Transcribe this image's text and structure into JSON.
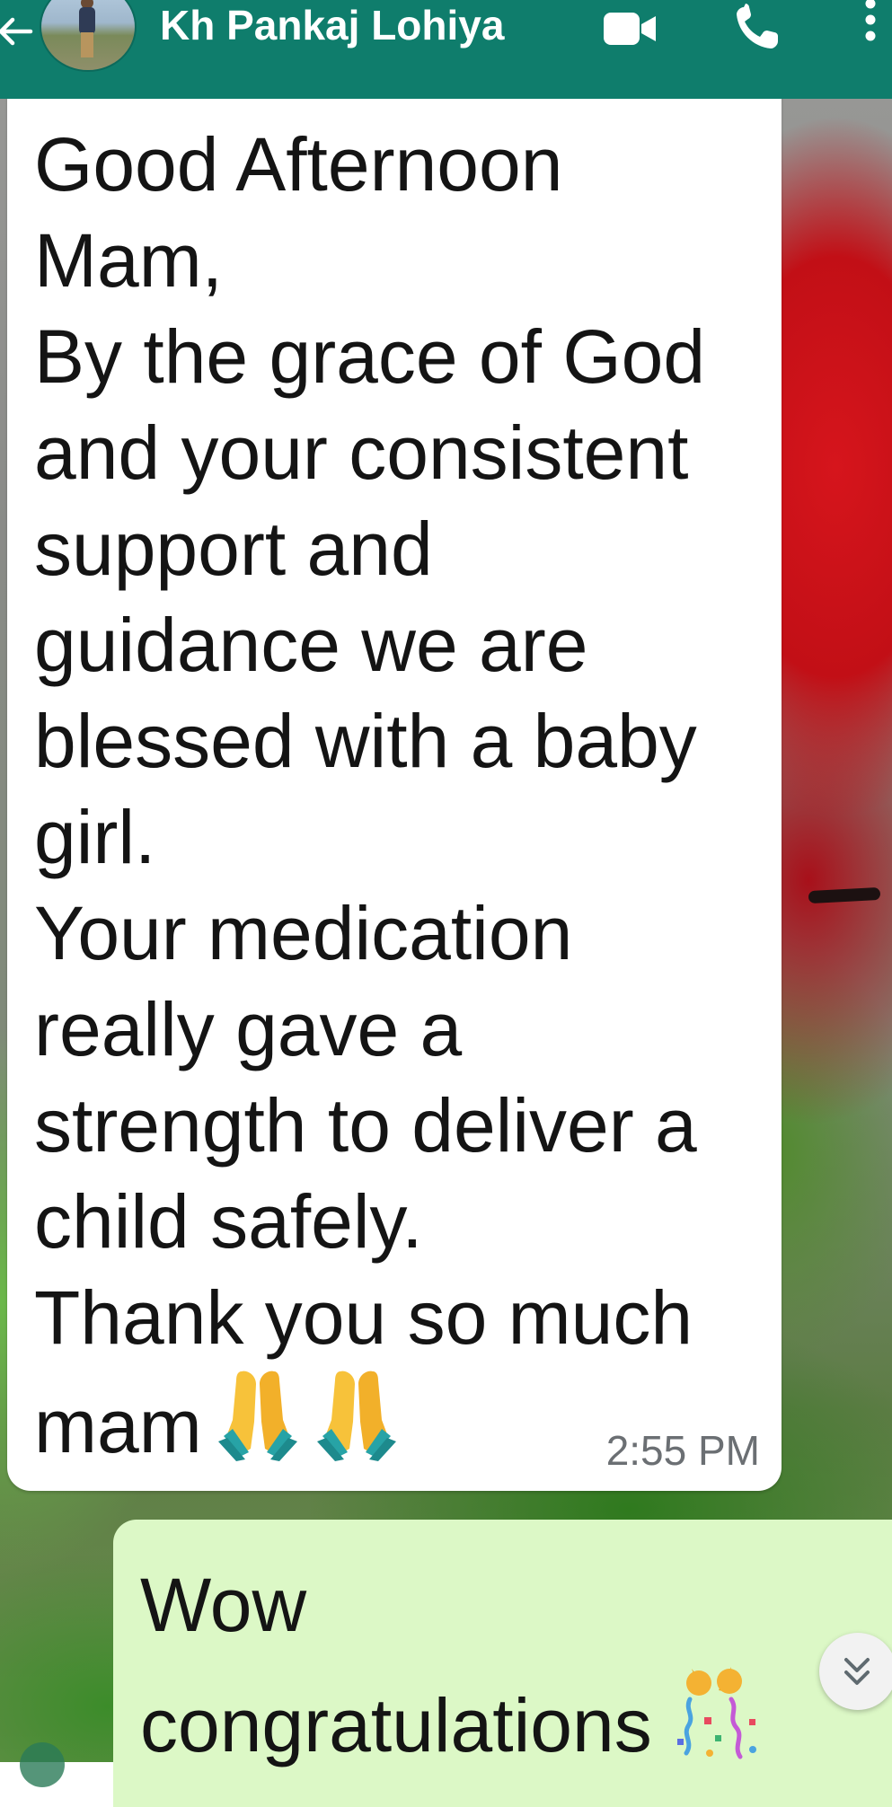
{
  "header": {
    "contact_name": "Kh Pankaj Lohiya",
    "background_color": "#0f7d6c",
    "icons": [
      "back-arrow-icon",
      "video-call-icon",
      "phone-call-icon",
      "more-options-icon"
    ]
  },
  "messages": [
    {
      "direction": "incoming",
      "text": "Good Afternoon\nMam,\nBy the grace of God\nand your consistent\nsupport and\nguidance we are\nblessed with a baby\ngirl.\nYour medication\nreally gave a\nstrength to deliver a\nchild safely.\nThank you so much\nmam",
      "emoji": [
        "folded-hands",
        "folded-hands"
      ],
      "time": "2:55 PM",
      "bubble_color": "#ffffff"
    },
    {
      "direction": "outgoing",
      "text": "Wow\ncongratulations",
      "emoji": [
        "party-popper"
      ],
      "bubble_color": "#dcf8c6"
    }
  ],
  "scroll_button": {
    "icon": "chevron-double-down-icon"
  }
}
